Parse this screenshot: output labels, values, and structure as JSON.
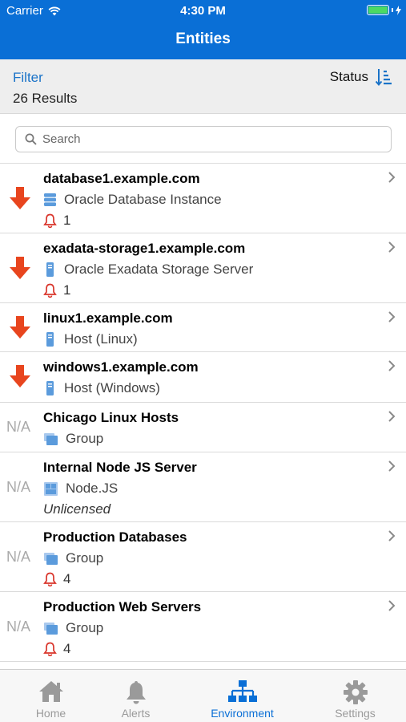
{
  "status_bar": {
    "carrier": "Carrier",
    "time": "4:30 PM"
  },
  "nav": {
    "title": "Entities"
  },
  "filter_bar": {
    "filter_label": "Filter",
    "results": "26 Results",
    "status_label": "Status"
  },
  "search": {
    "placeholder": "Search"
  },
  "colors": {
    "brand": "#0a6fd6",
    "alert": "#d9352b",
    "down": "#e8451e",
    "entity_icon": "#5b9bdc"
  },
  "entities": [
    {
      "name": "database1.example.com",
      "type": "Oracle Database Instance",
      "status": "down",
      "type_icon": "database-icon",
      "alerts": "1"
    },
    {
      "name": "exadata-storage1.example.com",
      "type": "Oracle Exadata Storage Server",
      "status": "down",
      "type_icon": "server-icon",
      "alerts": "1"
    },
    {
      "name": "linux1.example.com",
      "type": "Host (Linux)",
      "status": "down",
      "type_icon": "server-icon"
    },
    {
      "name": "windows1.example.com",
      "type": "Host (Windows)",
      "status": "down",
      "type_icon": "server-icon"
    },
    {
      "name": "Chicago Linux Hosts",
      "type": "Group",
      "status": "N/A",
      "type_icon": "group-icon"
    },
    {
      "name": "Internal Node JS Server",
      "type": "Node.JS",
      "status": "N/A",
      "type_icon": "nodejs-icon",
      "note": "Unlicensed"
    },
    {
      "name": "Production Databases",
      "type": "Group",
      "status": "N/A",
      "type_icon": "group-icon",
      "alerts": "4"
    },
    {
      "name": "Production Web Servers",
      "type": "Group",
      "status": "N/A",
      "type_icon": "group-icon",
      "alerts": "4"
    }
  ],
  "tabs": [
    {
      "label": "Home",
      "icon": "home-icon",
      "active": false
    },
    {
      "label": "Alerts",
      "icon": "bell-icon",
      "active": false
    },
    {
      "label": "Environment",
      "icon": "hierarchy-icon",
      "active": true
    },
    {
      "label": "Settings",
      "icon": "gear-icon",
      "active": false
    }
  ]
}
